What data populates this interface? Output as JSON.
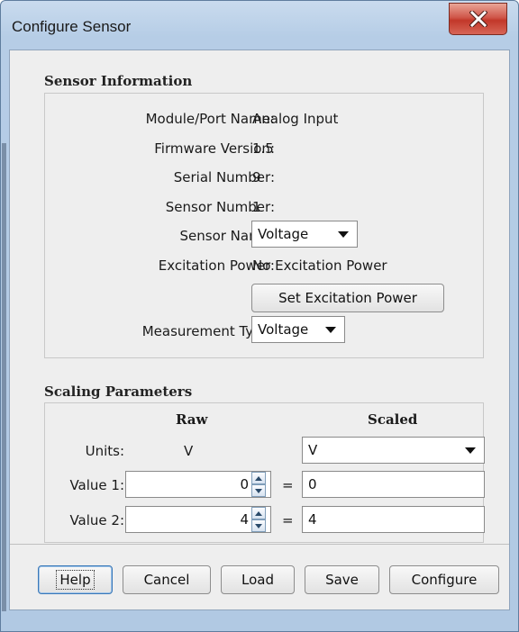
{
  "window": {
    "title": "Configure Sensor"
  },
  "sensor_info": {
    "heading": "Sensor Information",
    "module_port_label": "Module/Port Name:",
    "module_port_value": "Analog Input",
    "firmware_label": "Firmware Version:",
    "firmware_value": "1.5",
    "serial_label": "Serial Number:",
    "serial_value": "9",
    "sensor_number_label": "Sensor Number:",
    "sensor_number_value": "1",
    "sensor_name_label": "Sensor Name:",
    "sensor_name_value": "Voltage",
    "excitation_label": "Excitation Power:",
    "excitation_value": "No Excitation Power",
    "set_excitation_button": "Set Excitation Power",
    "measurement_type_label": "Measurement Type:",
    "measurement_type_value": "Voltage"
  },
  "scaling": {
    "heading": "Scaling Parameters",
    "raw_header": "Raw",
    "scaled_header": "Scaled",
    "units_label": "Units:",
    "raw_units": "V",
    "scaled_units": "V",
    "value1_label": "Value 1:",
    "value1_raw": "0",
    "value1_scaled": "0",
    "value2_label": "Value 2:",
    "value2_raw": "4",
    "value2_scaled": "4",
    "equals": "="
  },
  "buttons": {
    "help": "Help",
    "cancel": "Cancel",
    "load": "Load",
    "save": "Save",
    "configure": "Configure"
  },
  "icons": {
    "close": "close-icon",
    "dropdown": "chevron-down-icon",
    "spin_up": "spin-up-icon",
    "spin_down": "spin-down-icon"
  },
  "colors": {
    "title_bar": "#b6cde6",
    "close_button": "#c9473a",
    "dialog_background": "#eeeeee"
  }
}
